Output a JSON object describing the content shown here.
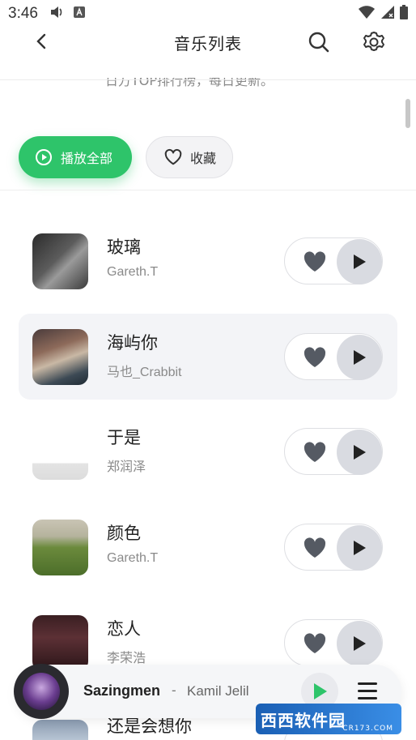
{
  "status_bar": {
    "time": "3:46"
  },
  "header": {
    "title": "音乐列表"
  },
  "description_partial": "日方TOP排行榜，每日更新。",
  "actions": {
    "play_all_label": "播放全部",
    "collect_label": "收藏"
  },
  "songs": [
    {
      "title": "玻璃",
      "artist": "Gareth.T",
      "active": false
    },
    {
      "title": "海屿你",
      "artist": "马也_Crabbit",
      "active": true
    },
    {
      "title": "于是",
      "artist": "郑润泽",
      "active": false
    },
    {
      "title": "颜色",
      "artist": "Gareth.T",
      "active": false
    },
    {
      "title": "恋人",
      "artist": "李荣浩",
      "active": false
    },
    {
      "title": "还是会想你",
      "artist": "",
      "active": false
    }
  ],
  "mini_player": {
    "track": "Sazingmen",
    "separator": "-",
    "artist": "Kamil Jelil"
  },
  "watermark": {
    "text": "西西软件园",
    "sub": "CR173.COM"
  },
  "colors": {
    "accent": "#2ec46a",
    "control_bg": "#d9dbe1",
    "icon_dark": "#444444"
  }
}
